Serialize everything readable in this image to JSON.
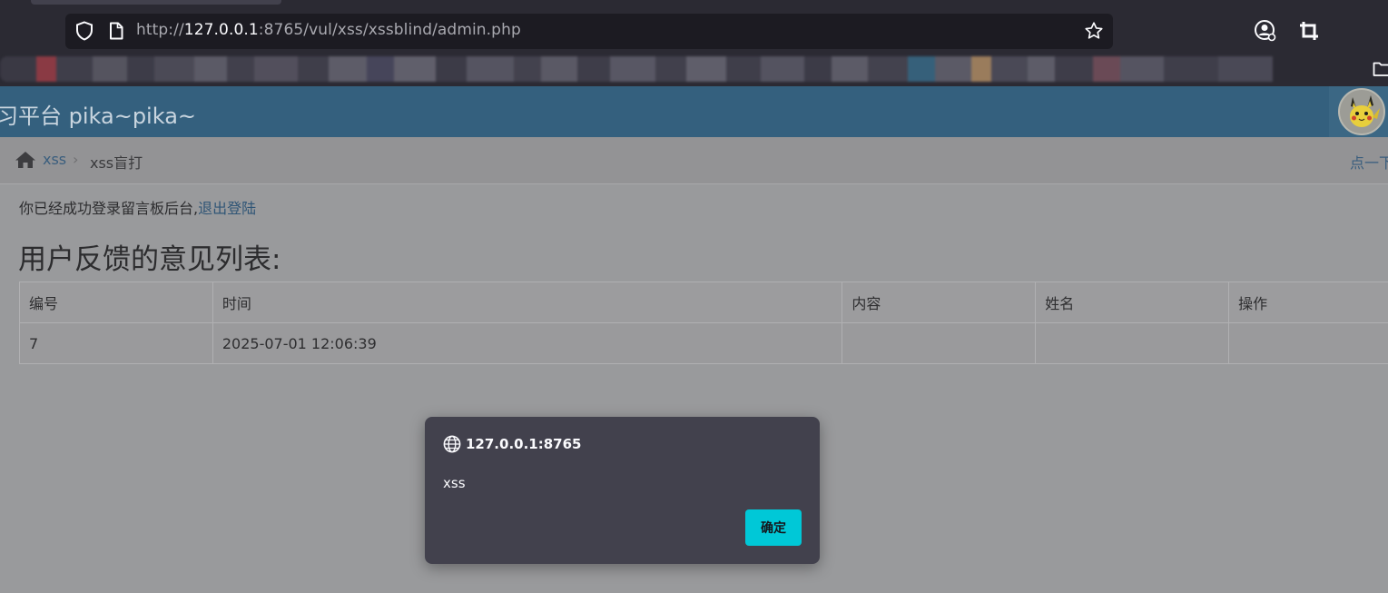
{
  "browser": {
    "url_scheme": "http://",
    "url_host": "127.0.0.1",
    "url_rest": ":8765/vul/xss/xssblind/admin.php"
  },
  "site": {
    "title": "习平台 pika~pika~"
  },
  "breadcrumb": {
    "link": "xss",
    "separator": "›",
    "current": "xss盲打",
    "right_link": "点一下"
  },
  "content": {
    "login_text": "你已经成功登录留言板后台,",
    "logout_link": "退出登陆",
    "heading": "用户反馈的意见列表:"
  },
  "table": {
    "headers": [
      "编号",
      "时间",
      "内容",
      "姓名",
      "操作"
    ],
    "rows": [
      [
        "7",
        "2025-07-01 12:06:39",
        "",
        "",
        ""
      ]
    ]
  },
  "dialog": {
    "origin": "127.0.0.1:8765",
    "message": "xss",
    "ok_label": "确定"
  },
  "colors": {
    "header": "#34607e",
    "link": "#2f5576",
    "dialog_bg": "#42414d",
    "ok_button": "#00c8d7"
  }
}
